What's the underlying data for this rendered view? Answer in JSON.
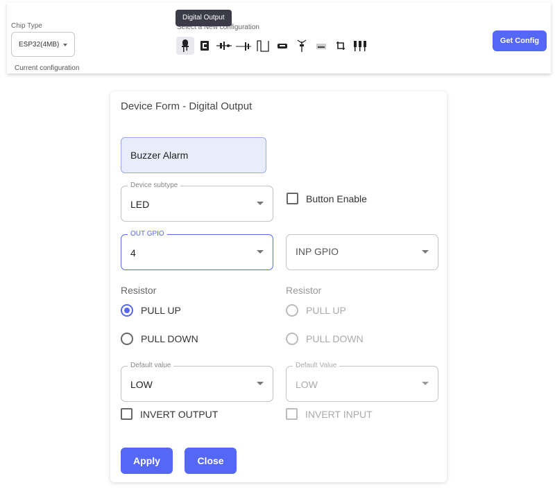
{
  "topbar": {
    "chip_type_label": "Chip Type",
    "chip_type_value": "ESP32(4MB)",
    "current_config_label": "Current configuration",
    "tooltip": "Digital Output",
    "select_new_label": "Select a New configuration",
    "get_config_label": "Get Config",
    "icons": [
      "digital-output-icon",
      "display-icon",
      "sensor-icon",
      "analog-icon",
      "pulse-icon",
      "module-icon",
      "antenna-icon",
      "chip-icon",
      "crop-icon",
      "relay-bank-icon"
    ]
  },
  "form": {
    "title": "Device Form - Digital Output",
    "name_value": "Buzzer Alarm",
    "device_subtype": {
      "label": "Device subtype",
      "value": "LED"
    },
    "button_enable_label": "Button Enable",
    "out_gpio": {
      "label": "OUT GPIO",
      "value": "4"
    },
    "inp_gpio": {
      "placeholder": "INP GPIO"
    },
    "resistor_left": {
      "label": "Resistor",
      "pull_up": "PULL UP",
      "pull_down": "PULL DOWN",
      "selected": "PULL UP"
    },
    "resistor_right": {
      "label": "Resistor",
      "pull_up": "PULL UP",
      "pull_down": "PULL DOWN"
    },
    "default_value_left": {
      "label": "Default value",
      "value": "LOW"
    },
    "default_value_right": {
      "label": "Default Value",
      "value": "LOW"
    },
    "invert_output_label": "INVERT OUTPUT",
    "invert_input_label": "INVERT INPUT",
    "apply_label": "Apply",
    "close_label": "Close"
  },
  "colors": {
    "accent": "#5567f5",
    "name_field_bg": "#e8edfc"
  }
}
